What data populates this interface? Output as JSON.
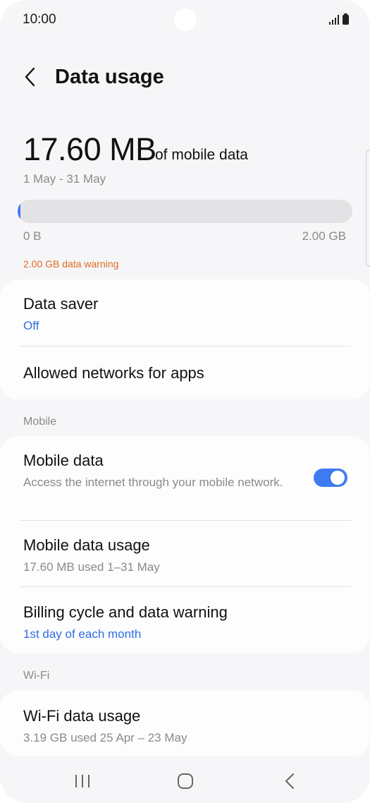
{
  "status_bar": {
    "time": "10:00"
  },
  "header": {
    "title": "Data usage"
  },
  "usage": {
    "amount": "17.60 MB",
    "suffix": "of mobile data",
    "range": "1 May - 31 May",
    "bar_min": "0 B",
    "bar_max": "2.00 GB",
    "used_fraction": 0.0086,
    "warning": "2.00 GB data warning"
  },
  "card1": {
    "data_saver": {
      "title": "Data saver",
      "subtitle": "Off"
    },
    "allowed_networks": {
      "title": "Allowed networks for apps"
    }
  },
  "section_mobile": "Mobile",
  "card2": {
    "mobile_data": {
      "title": "Mobile data",
      "subtitle": "Access the internet through your mobile network.",
      "enabled": true
    },
    "mobile_data_usage": {
      "title": "Mobile data usage",
      "subtitle": "17.60 MB used 1–31 May"
    },
    "billing_cycle": {
      "title": "Billing cycle and data warning",
      "subtitle": "1st day of each month"
    }
  },
  "section_wifi": "Wi-Fi",
  "card3": {
    "wifi_data_usage": {
      "title": "Wi-Fi data usage",
      "subtitle": "3.19 GB used 25 Apr – 23 May"
    }
  },
  "colors": {
    "accent": "#3e7bf0",
    "link_blue": "#2f6ce0",
    "warning_orange": "#e06a22"
  },
  "icons": {
    "back": "chevron-left-icon",
    "recents": "recent-apps-icon",
    "home": "home-icon",
    "nav_back": "nav-back-icon"
  }
}
